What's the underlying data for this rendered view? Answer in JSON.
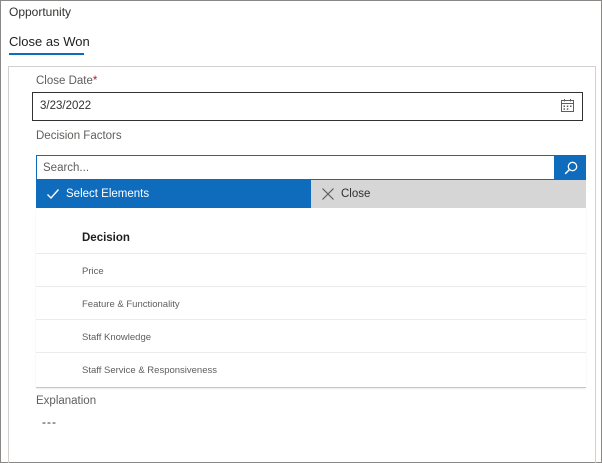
{
  "window": {
    "title": "Opportunity"
  },
  "tab": {
    "label": "Close as Won"
  },
  "close_date": {
    "label": "Close Date",
    "required_marker": "*",
    "value": "3/23/2022",
    "icon": "calendar-icon"
  },
  "decision_factors": {
    "label": "Decision Factors",
    "search_placeholder": "Search...",
    "search_icon": "search-icon",
    "select_label": "Select Elements",
    "close_label": "Close",
    "column_header": "Decision",
    "items": [
      {
        "label": "Price"
      },
      {
        "label": "Feature & Functionality"
      },
      {
        "label": "Staff Knowledge"
      },
      {
        "label": "Staff Service & Responsiveness"
      }
    ]
  },
  "explanation": {
    "label": "Explanation",
    "value": "---"
  },
  "colors": {
    "accent": "#0f6cbd",
    "close_bg": "#d6d6d6",
    "required": "#a4262c"
  }
}
